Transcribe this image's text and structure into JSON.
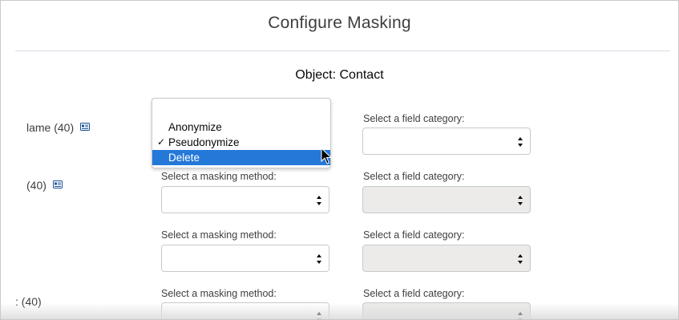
{
  "dialog": {
    "title": "Configure Masking",
    "object_title": "Object: Contact"
  },
  "rows": [
    {
      "field_label": "lame (40)",
      "method_label": "",
      "category_label": "Select a field category:",
      "category_disabled": false
    },
    {
      "field_label": "(40)",
      "method_label": "Select a masking method:",
      "category_label": "Select a field category:",
      "category_disabled": true
    },
    {
      "field_label": "",
      "method_label": "Select a masking method:",
      "category_label": "Select a field category:",
      "category_disabled": true
    },
    {
      "field_label": ": (40)",
      "method_label": "Select a masking method:",
      "category_label": "Select a field category:",
      "category_disabled": true
    }
  ],
  "dropdown": {
    "options": [
      "Anonymize",
      "Pseudonymize",
      "Delete"
    ],
    "checked_option": "Pseudonymize",
    "highlighted_option": "Delete",
    "check_mark": "✓"
  },
  "icons": {
    "info": "info-card-icon",
    "select_arrows": "up-down-arrows-icon",
    "cursor": "mouse-pointer-icon"
  },
  "colors": {
    "highlight": "#2478d8",
    "info_icon": "#1b5297",
    "disabled_select": "#ecebea"
  }
}
